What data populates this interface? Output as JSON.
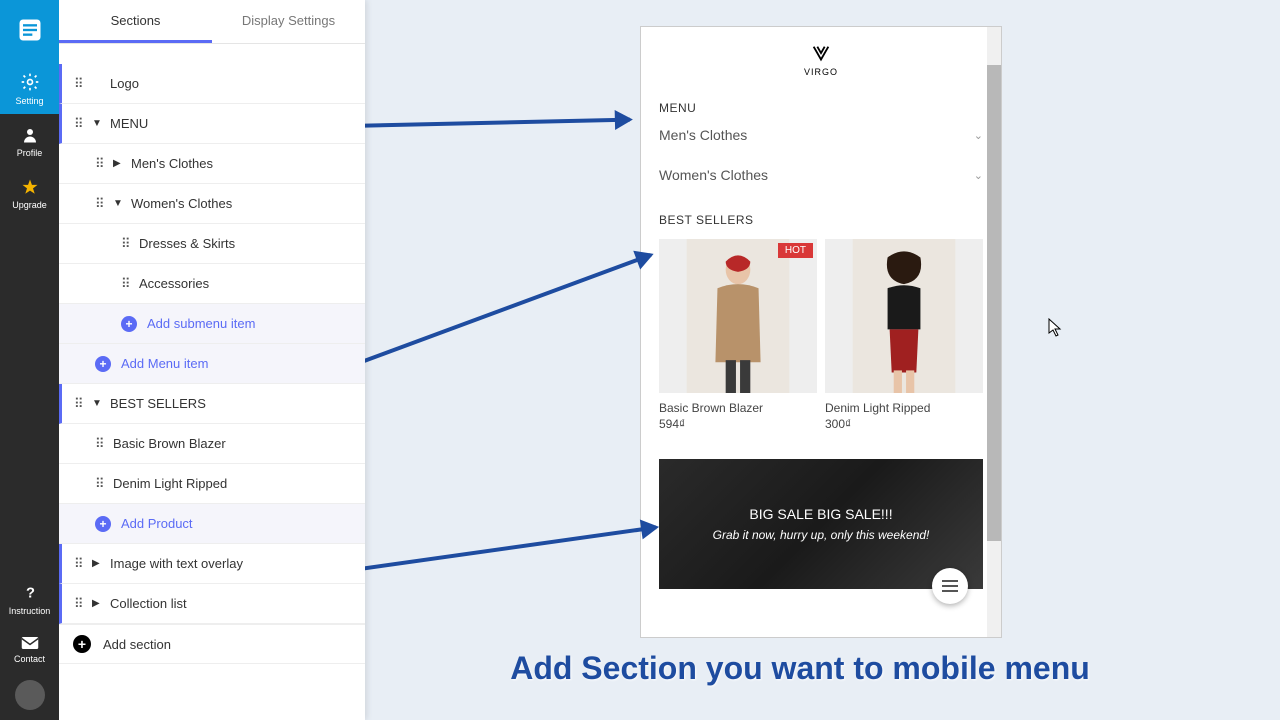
{
  "sidebar": {
    "setting": "Setting",
    "profile": "Profile",
    "upgrade": "Upgrade",
    "instruction": "Instruction",
    "contact": "Contact"
  },
  "tabs": {
    "sections": "Sections",
    "display_settings": "Display Settings"
  },
  "tree": {
    "logo": "Logo",
    "menu": "MENU",
    "mens": "Men's Clothes",
    "womens": "Women's Clothes",
    "dresses": "Dresses & Skirts",
    "accessories": "Accessories",
    "add_submenu": "Add submenu item",
    "add_menu_item": "Add Menu item",
    "best_sellers": "BEST SELLERS",
    "prod1": "Basic Brown Blazer",
    "prod2": "Denim Light Ripped",
    "add_product": "Add Product",
    "image_overlay": "Image with text overlay",
    "collection_list": "Collection list",
    "add_section": "Add section"
  },
  "preview": {
    "brand": "VIRGO",
    "menu_heading": "MENU",
    "mens": "Men's Clothes",
    "womens": "Women's Clothes",
    "best_heading": "BEST SELLERS",
    "hot": "HOT",
    "p1_name": "Basic Brown Blazer",
    "p1_price": "594₫",
    "p2_name": "Denim Light Ripped",
    "p2_price": "300₫",
    "banner_title": "BIG SALE BIG SALE!!!",
    "banner_sub": "Grab it now, hurry up, only this weekend!"
  },
  "caption": "Add Section you want to mobile menu"
}
